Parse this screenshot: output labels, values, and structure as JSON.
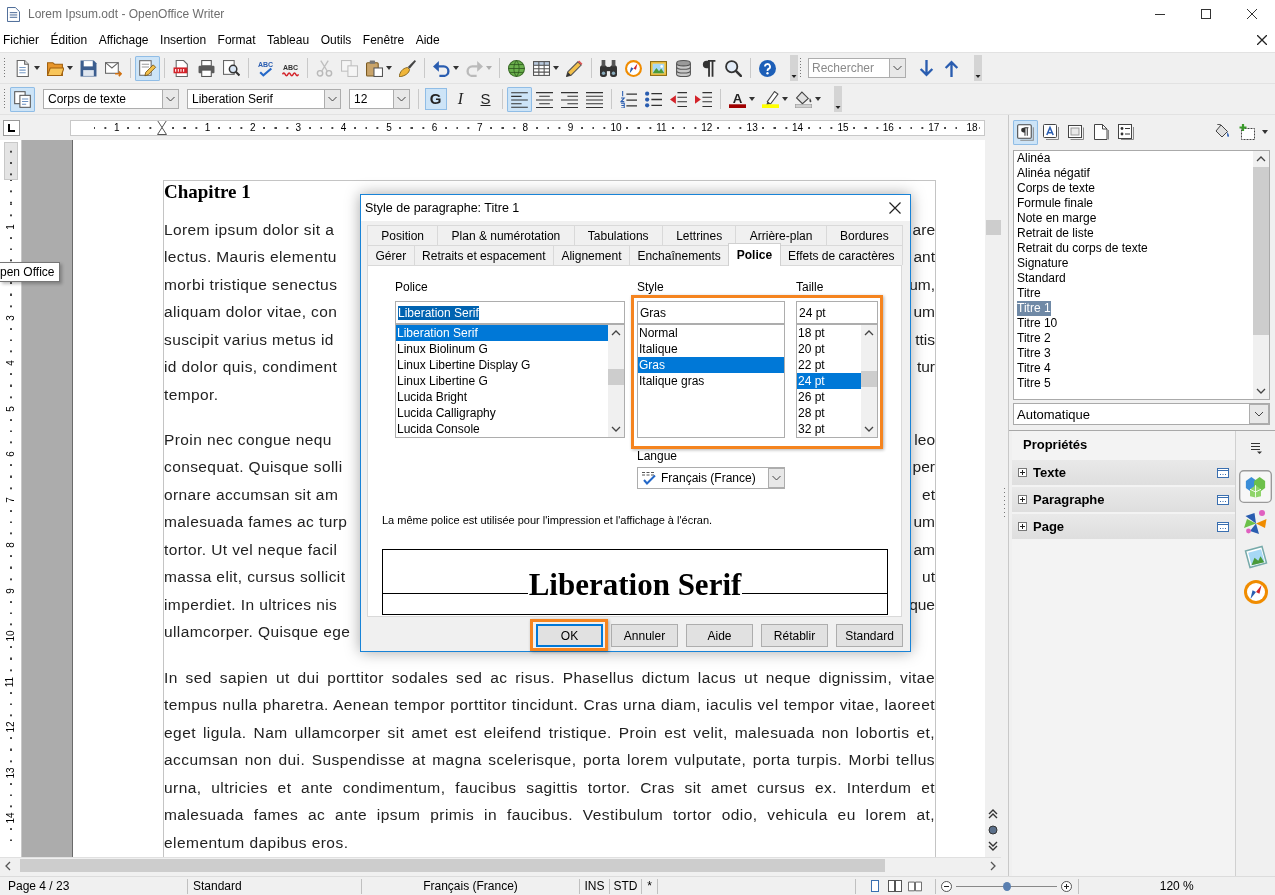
{
  "window": {
    "title": "Lorem Ipsum.odt - OpenOffice Writer"
  },
  "menu": [
    "Fichier",
    "Édition",
    "Affichage",
    "Insertion",
    "Format",
    "Tableau",
    "Outils",
    "Fenêtre",
    "Aide"
  ],
  "standard_toolbar": {
    "groups": [
      [
        {
          "kind": "new",
          "dropdown": true,
          "pressed": false,
          "disabled": false
        },
        {
          "kind": "open",
          "dropdown": true,
          "pressed": false,
          "disabled": false
        },
        {
          "kind": "save",
          "dropdown": false,
          "pressed": false,
          "disabled": false
        },
        {
          "kind": "email",
          "dropdown": false,
          "pressed": false,
          "disabled": false
        }
      ],
      [
        {
          "kind": "edit",
          "dropdown": false,
          "pressed": true,
          "disabled": false
        }
      ],
      [
        {
          "kind": "pdf",
          "dropdown": false,
          "pressed": false,
          "disabled": false
        },
        {
          "kind": "print",
          "dropdown": false,
          "pressed": false,
          "disabled": false
        },
        {
          "kind": "preview",
          "dropdown": false,
          "pressed": false,
          "disabled": false
        }
      ],
      [
        {
          "kind": "spell",
          "label": "ABC",
          "dropdown": false,
          "pressed": false,
          "disabled": false
        },
        {
          "kind": "autospell",
          "label": "ABC",
          "dropdown": false,
          "pressed": false,
          "disabled": false
        }
      ],
      [
        {
          "kind": "cut",
          "dropdown": false,
          "pressed": false,
          "disabled": true
        },
        {
          "kind": "copy",
          "dropdown": false,
          "pressed": false,
          "disabled": true
        },
        {
          "kind": "paste",
          "dropdown": true,
          "pressed": false,
          "disabled": false
        },
        {
          "kind": "brush",
          "dropdown": false,
          "pressed": false,
          "disabled": false
        }
      ],
      [
        {
          "kind": "undo",
          "dropdown": true,
          "pressed": false,
          "disabled": false
        },
        {
          "kind": "redo",
          "dropdown": true,
          "pressed": false,
          "disabled": true
        }
      ],
      [
        {
          "kind": "hyperlink",
          "dropdown": false,
          "pressed": false,
          "disabled": false
        },
        {
          "kind": "table",
          "dropdown": true,
          "pressed": false,
          "disabled": false
        },
        {
          "kind": "draw",
          "dropdown": false,
          "pressed": false,
          "disabled": false
        }
      ],
      [
        {
          "kind": "find",
          "dropdown": false,
          "pressed": false,
          "disabled": false
        },
        {
          "kind": "navigator",
          "dropdown": false,
          "pressed": false,
          "disabled": false
        },
        {
          "kind": "gallery",
          "dropdown": false,
          "pressed": false,
          "disabled": false
        },
        {
          "kind": "datasource",
          "dropdown": false,
          "pressed": false,
          "disabled": false
        },
        {
          "kind": "marks",
          "dropdown": false,
          "pressed": false,
          "disabled": false
        },
        {
          "kind": "zoom",
          "dropdown": false,
          "pressed": false,
          "disabled": false
        }
      ],
      [
        {
          "kind": "help",
          "dropdown": false,
          "pressed": false,
          "disabled": false
        }
      ]
    ]
  },
  "find_toolbar": {
    "placeholder": "Rechercher"
  },
  "formatting_toolbar": {
    "leading": [
      {
        "kind": "styles",
        "dropdown": false,
        "pressed": true
      }
    ],
    "paragraph_style": "Corps de texte",
    "font_name": "Liberation Serif",
    "font_size": "12",
    "groups": [
      [
        {
          "kind": "bold",
          "label": "G",
          "dropdown": false,
          "pressed": true
        },
        {
          "kind": "italic",
          "label": "I",
          "dropdown": false,
          "pressed": false
        },
        {
          "kind": "underline",
          "label": "S",
          "dropdown": false,
          "pressed": false
        }
      ],
      [
        {
          "kind": "left",
          "dropdown": false,
          "pressed": true
        },
        {
          "kind": "center",
          "dropdown": false,
          "pressed": false
        },
        {
          "kind": "right",
          "dropdown": false,
          "pressed": false
        },
        {
          "kind": "justify",
          "dropdown": false,
          "pressed": false
        }
      ],
      [
        {
          "kind": "numbering",
          "dropdown": false,
          "pressed": false
        },
        {
          "kind": "bullets",
          "dropdown": false,
          "pressed": false
        },
        {
          "kind": "outdent",
          "dropdown": false,
          "pressed": false
        },
        {
          "kind": "indent",
          "dropdown": false,
          "pressed": false
        }
      ],
      [
        {
          "kind": "fontcolor",
          "label": "A",
          "dropdown": true,
          "pressed": false
        },
        {
          "kind": "highlight",
          "dropdown": true,
          "pressed": false
        },
        {
          "kind": "background",
          "dropdown": true,
          "pressed": false
        }
      ]
    ]
  },
  "rulers": {
    "horizontal": [
      "1",
      "1",
      "2",
      "3",
      "4",
      "5",
      "6",
      "7",
      "8",
      "9",
      "10",
      "11",
      "12",
      "13",
      "14",
      "15",
      "16",
      "17",
      "18"
    ],
    "vertical_upper": [
      "1"
    ],
    "vertical_lower": [
      "3",
      "4",
      "5",
      "6",
      "7",
      "8",
      "9",
      "10",
      "11",
      "12",
      "13",
      "14"
    ]
  },
  "tooltip": "pen Office",
  "document": {
    "heading": "Chapitre 1",
    "covered_paragraphs": [
      [
        {
          "left": "Lorem ipsum dolor sit a",
          "right": "are"
        },
        {
          "left": "lectus. Mauris elementu",
          "right": "ant"
        },
        {
          "left": "morbi tristique senectus",
          "right": "um,"
        },
        {
          "left": "aliquam dolor vitae, con",
          "right": "um"
        },
        {
          "left": "suscipit varius metus id",
          "right": "ttis"
        },
        {
          "left": "id dolor quis, condiment",
          "right": "tur"
        },
        {
          "left": "tempor."
        }
      ],
      [
        {
          "left": "Proin nec congue nequ",
          "right": "leo"
        },
        {
          "left": "consequat. Quisque solli",
          "right": "per"
        },
        {
          "left": "ornare accumsan sit am",
          "right": "et"
        },
        {
          "left": "malesuada fames ac turp",
          "right": "um"
        },
        {
          "left": "tortor. Ut vel neque facil",
          "right": "am"
        },
        {
          "left": "massa elit, cursus sollicit",
          "right": "ut"
        },
        {
          "left": "imperdiet. In ultrices nis",
          "right": "que"
        },
        {
          "left": "ullamcorper. Quisque ege"
        }
      ]
    ],
    "paragraph": "In sed sapien ut dui porttitor sodales sed ac risus. Phasellus dictum lacus ut neque dignissim, vitae tempus nulla pharetra. Aenean tempor porttitor tincidunt. Cras urna diam, iaculis vel tempor vitae, laoreet eget ligula. Nam ullamcorper sit amet est eleifend tristique. Proin est velit, malesuada non lobortis et, accumsan non dui. Suspendisse at magna scelerisque, porta lorem vulputate, porta turpis. Morbi tellus urna, ultricies et ante condimentum, faucibus sagittis tortor. Cras sit amet cursus ex. Interdum et malesuada fames ac ante ipsum primis in faucibus. Vestibulum tortor odio, vehicula eu lorem at, elementum dapibus eros."
  },
  "sidebar": {
    "style_families": [
      {
        "kind": "paragraph",
        "selected": true
      },
      {
        "kind": "character",
        "selected": false
      },
      {
        "kind": "frame",
        "selected": false
      },
      {
        "kind": "page",
        "selected": false
      },
      {
        "kind": "list",
        "selected": false
      }
    ],
    "styles": [
      {
        "label": "Alinéa",
        "selected": false
      },
      {
        "label": "Alinéa négatif",
        "selected": false
      },
      {
        "label": "Corps de texte",
        "selected": false
      },
      {
        "label": "Formule finale",
        "selected": false
      },
      {
        "label": "Note en marge",
        "selected": false
      },
      {
        "label": "Retrait de liste",
        "selected": false
      },
      {
        "label": "Retrait du corps de texte",
        "selected": false
      },
      {
        "label": "Signature",
        "selected": false
      },
      {
        "label": "Standard",
        "selected": false
      },
      {
        "label": "Titre",
        "selected": false
      },
      {
        "label": "Titre 1",
        "selected": true
      },
      {
        "label": "Titre 10",
        "selected": false
      },
      {
        "label": "Titre 2",
        "selected": false
      },
      {
        "label": "Titre 3",
        "selected": false
      },
      {
        "label": "Titre 4",
        "selected": false
      },
      {
        "label": "Titre 5",
        "selected": false
      }
    ],
    "style_filter": "Automatique",
    "properties": {
      "title": "Propriétés",
      "sections": [
        {
          "label": "Texte",
          "expanded": false
        },
        {
          "label": "Paragraphe",
          "expanded": false
        },
        {
          "label": "Page",
          "expanded": false
        }
      ]
    },
    "deck_tabs": [
      {
        "kind": "properties",
        "selected": true
      },
      {
        "kind": "styles",
        "selected": false
      },
      {
        "kind": "gallery",
        "selected": false
      },
      {
        "kind": "navigator",
        "selected": false
      }
    ]
  },
  "dialog": {
    "title": "Style de paragraphe: Titre 1",
    "tab_rows": [
      [
        {
          "label": "Position",
          "selected": false
        },
        {
          "label": "Plan & numérotation",
          "selected": false
        },
        {
          "label": "Tabulations",
          "selected": false
        },
        {
          "label": "Lettrines",
          "selected": false
        },
        {
          "label": "Arrière-plan",
          "selected": false
        },
        {
          "label": "Bordures",
          "selected": false
        }
      ],
      [
        {
          "label": "Gérer",
          "selected": false
        },
        {
          "label": "Retraits et espacement",
          "selected": false
        },
        {
          "label": "Alignement",
          "selected": false
        },
        {
          "label": "Enchaînements",
          "selected": false
        },
        {
          "label": "Police",
          "selected": true
        },
        {
          "label": "Effets de caractères",
          "selected": false
        }
      ]
    ],
    "font": {
      "label": "Police",
      "value": "Liberation Serif",
      "value_selected": true,
      "options": [
        {
          "label": "Liberation Serif",
          "selected": true
        },
        {
          "label": "Linux Biolinum G",
          "selected": false
        },
        {
          "label": "Linux Libertine Display G",
          "selected": false
        },
        {
          "label": "Linux Libertine G",
          "selected": false
        },
        {
          "label": "Lucida Bright",
          "selected": false
        },
        {
          "label": "Lucida Calligraphy",
          "selected": false
        },
        {
          "label": "Lucida Console",
          "selected": false
        }
      ]
    },
    "style": {
      "label": "Style",
      "value": "Gras",
      "value_selected": false,
      "options": [
        {
          "label": "Normal",
          "selected": false
        },
        {
          "label": "Italique",
          "selected": false
        },
        {
          "label": "Gras",
          "selected": true
        },
        {
          "label": "Italique gras",
          "selected": false
        }
      ]
    },
    "size": {
      "label": "Taille",
      "value": "24 pt",
      "value_selected": false,
      "options": [
        {
          "label": "18 pt",
          "selected": false
        },
        {
          "label": "20 pt",
          "selected": false
        },
        {
          "label": "22 pt",
          "selected": false
        },
        {
          "label": "24 pt",
          "selected": true
        },
        {
          "label": "26 pt",
          "selected": false
        },
        {
          "label": "28 pt",
          "selected": false
        },
        {
          "label": "32 pt",
          "selected": false
        }
      ]
    },
    "style_size_highlighted": true,
    "language": {
      "label": "Langue",
      "value": "Français (France)"
    },
    "note": "La même police est utilisée pour l'impression et l'affichage à l'écran.",
    "preview": "Liberation Serif",
    "buttons": [
      {
        "label": "OK",
        "default": true,
        "highlighted": true
      },
      {
        "label": "Annuler",
        "default": false,
        "highlighted": false
      },
      {
        "label": "Aide",
        "default": false,
        "highlighted": false
      },
      {
        "label": "Rétablir",
        "default": false,
        "highlighted": false
      },
      {
        "label": "Standard",
        "default": false,
        "highlighted": false
      }
    ]
  },
  "status_bar": {
    "page": "Page 4 / 23",
    "page_style": "Standard",
    "language": "Français (France)",
    "insert_mode": "INS",
    "selection_mode": "STD",
    "modified": "*",
    "zoom": {
      "level": 0.5,
      "reading": "120 %"
    }
  }
}
